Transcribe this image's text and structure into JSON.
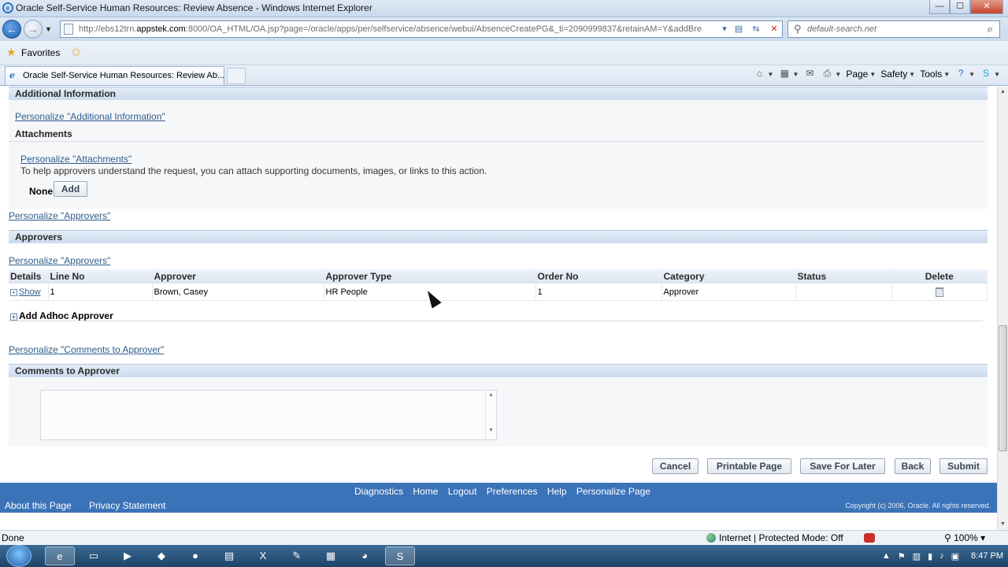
{
  "window": {
    "title": "Oracle Self-Service Human Resources: Review Absence - Windows Internet Explorer",
    "min": "—",
    "max": "☐",
    "close": "✕"
  },
  "nav": {
    "url_host_prefix": "http://ebs12trn.",
    "url_host_main": "appstek.com",
    "url_rest": ":8000/OA_HTML/OA.jsp?page=/oracle/apps/per/selfservice/absence/webui/AbsenceCreatePG&_ti=2090999837&retainAM=Y&addBre",
    "search_placeholder": "default-search.net"
  },
  "favorites": {
    "label": "Favorites"
  },
  "tabs": [
    {
      "label": "Oracle Self-Service Human Resources: Review Ab..."
    }
  ],
  "commandbar": {
    "page": "Page",
    "safety": "Safety",
    "tools": "Tools"
  },
  "additional_info": {
    "title": "Additional Information",
    "personalize": "Personalize \"Additional Information\""
  },
  "attachments": {
    "title": "Attachments",
    "personalize": "Personalize \"Attachments\"",
    "help_text": "To help approvers understand the request, you can attach supporting documents, images, or links to this action.",
    "none_label": "None",
    "add_button": "Add"
  },
  "approvers": {
    "personalize_outer": "Personalize \"Approvers\"",
    "title": "Approvers",
    "personalize_inner": "Personalize \"Approvers\"",
    "columns": [
      "Details",
      "Line No",
      "Approver",
      "Approver Type",
      "Order No",
      "Category",
      "Status",
      "Delete"
    ],
    "rows": [
      {
        "details": "Show",
        "line_no": "1",
        "approver": "Brown, Casey",
        "approver_type": "HR People",
        "order_no": "1",
        "category": "Approver",
        "status": ""
      }
    ],
    "add_adhoc": "Add Adhoc Approver"
  },
  "comments": {
    "personalize": "Personalize \"Comments to Approver\"",
    "title": "Comments to Approver",
    "value": ""
  },
  "actions": {
    "cancel": "Cancel",
    "printable": "Printable Page",
    "save_later": "Save For Later",
    "back": "Back",
    "submit": "Submit"
  },
  "footer": {
    "links": [
      "Diagnostics",
      "Home",
      "Logout",
      "Preferences",
      "Help",
      "Personalize Page"
    ],
    "about": "About this Page",
    "privacy": "Privacy Statement",
    "copyright": "Copyright (c) 2006, Oracle. All rights reserved."
  },
  "status": {
    "left": "Done",
    "zone": "Internet | Protected Mode: Off",
    "zoom": "100%"
  },
  "taskbar": {
    "clock": "8:47 PM"
  },
  "colors": {
    "oracle_blue": "#3b73b9",
    "section_bar": "#cbdbee",
    "link": "#2e5d8a"
  }
}
